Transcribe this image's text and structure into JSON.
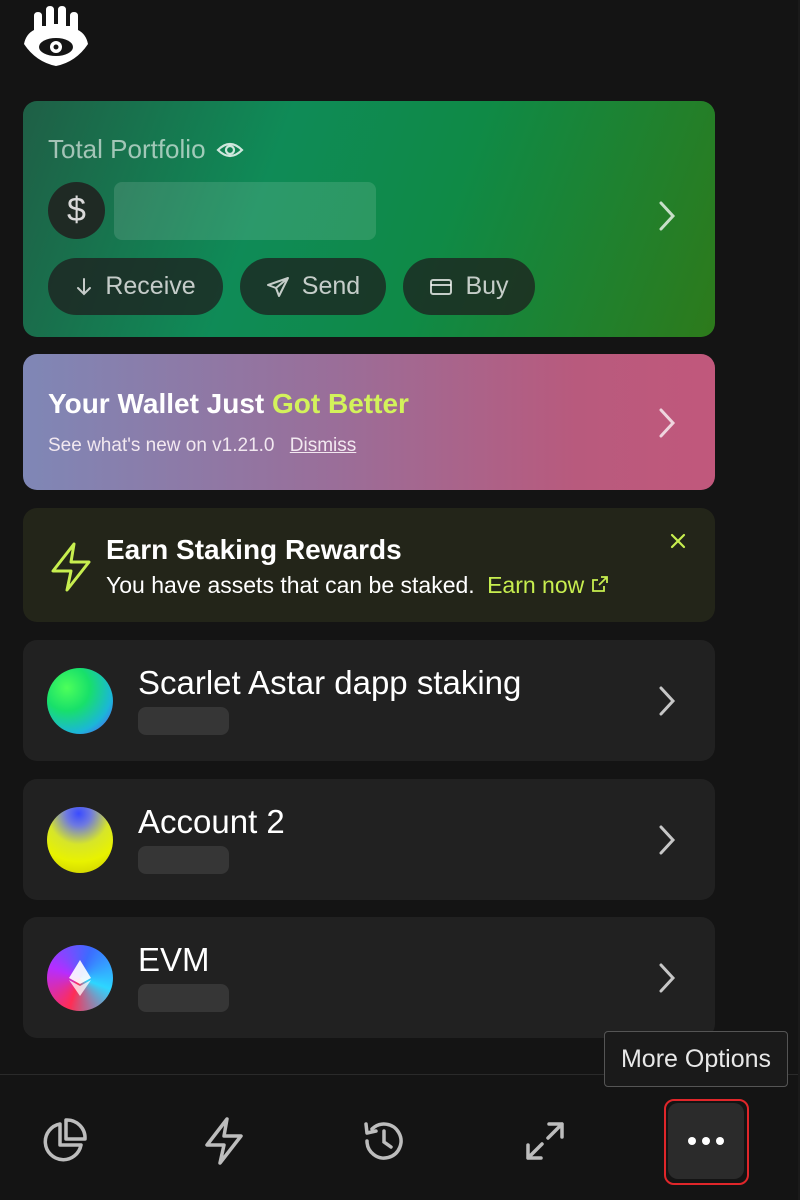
{
  "portfolio": {
    "title": "Total Portfolio",
    "currency_symbol": "$",
    "actions": [
      {
        "label": "Receive",
        "icon": "arrow-down-icon"
      },
      {
        "label": "Send",
        "icon": "paper-plane-icon"
      },
      {
        "label": "Buy",
        "icon": "card-icon"
      }
    ]
  },
  "promo": {
    "title_prefix": "Your Wallet Just",
    "title_highlight": "Got Better",
    "subtitle": "See what's new on v1.21.0",
    "dismiss": "Dismiss"
  },
  "earn": {
    "title": "Earn Staking Rewards",
    "subtitle": "You have assets that can be staked.",
    "link": "Earn now"
  },
  "accounts": [
    {
      "name": "Scarlet Astar dapp staking"
    },
    {
      "name": "Account 2"
    },
    {
      "name": "EVM"
    }
  ],
  "nav": {
    "items": [
      "portfolio-pie-icon",
      "lightning-icon",
      "history-icon",
      "expand-icon",
      "more-options-icon"
    ],
    "tooltip": "More Options"
  },
  "colors": {
    "accent_green": "#d3f25b",
    "earn_link": "#c7ee4f",
    "highlight_border": "#e0262a"
  }
}
